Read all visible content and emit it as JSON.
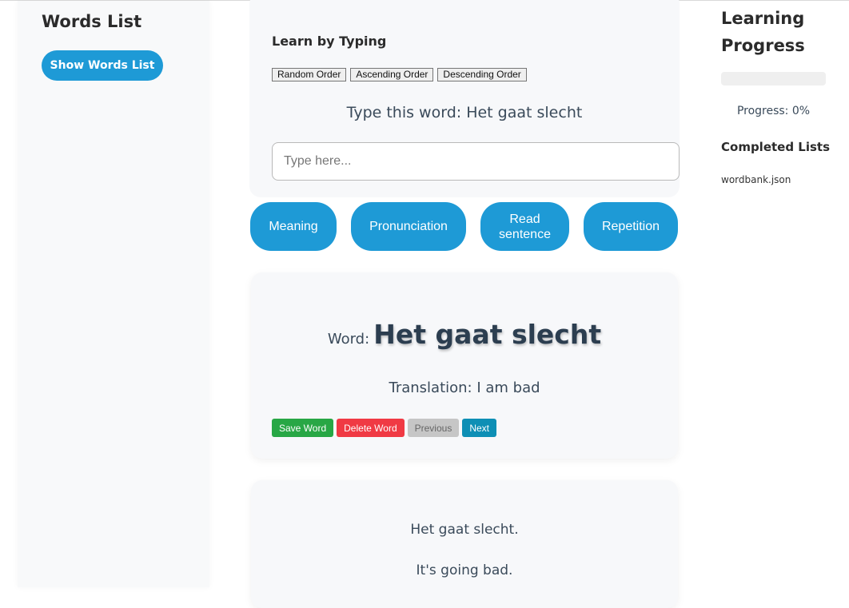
{
  "left_sidebar": {
    "title": "Words List",
    "show_button": "Show Words List"
  },
  "typing": {
    "title": "Learn by Typing",
    "order_buttons": [
      "Random Order",
      "Ascending Order",
      "Descending Order"
    ],
    "prompt": "Type this word: Het gaat slecht",
    "input_value": "",
    "input_placeholder": "Type here..."
  },
  "actions": [
    "Meaning",
    "Pronunciation",
    "Read sentence",
    "Repetition"
  ],
  "word_card": {
    "label": "Word:",
    "word": "Het gaat slecht",
    "translation": "Translation: I am bad",
    "buttons": {
      "save": "Save Word",
      "delete": "Delete Word",
      "previous": "Previous",
      "next": "Next"
    }
  },
  "sentence_card": {
    "sentence": "Het gaat slecht.",
    "translation": "It's going bad."
  },
  "right_panel": {
    "title": "Learning Progress",
    "progress_value": 0,
    "progress_text": "Progress: 0%",
    "completed_title": "Completed Lists",
    "completed_items": [
      "wordbank.json"
    ]
  },
  "colors": {
    "accent": "#1e9ad6",
    "save": "#28a745",
    "delete": "#f03a44",
    "previous": "#c6c6c6",
    "next": "#0e8fb5"
  }
}
